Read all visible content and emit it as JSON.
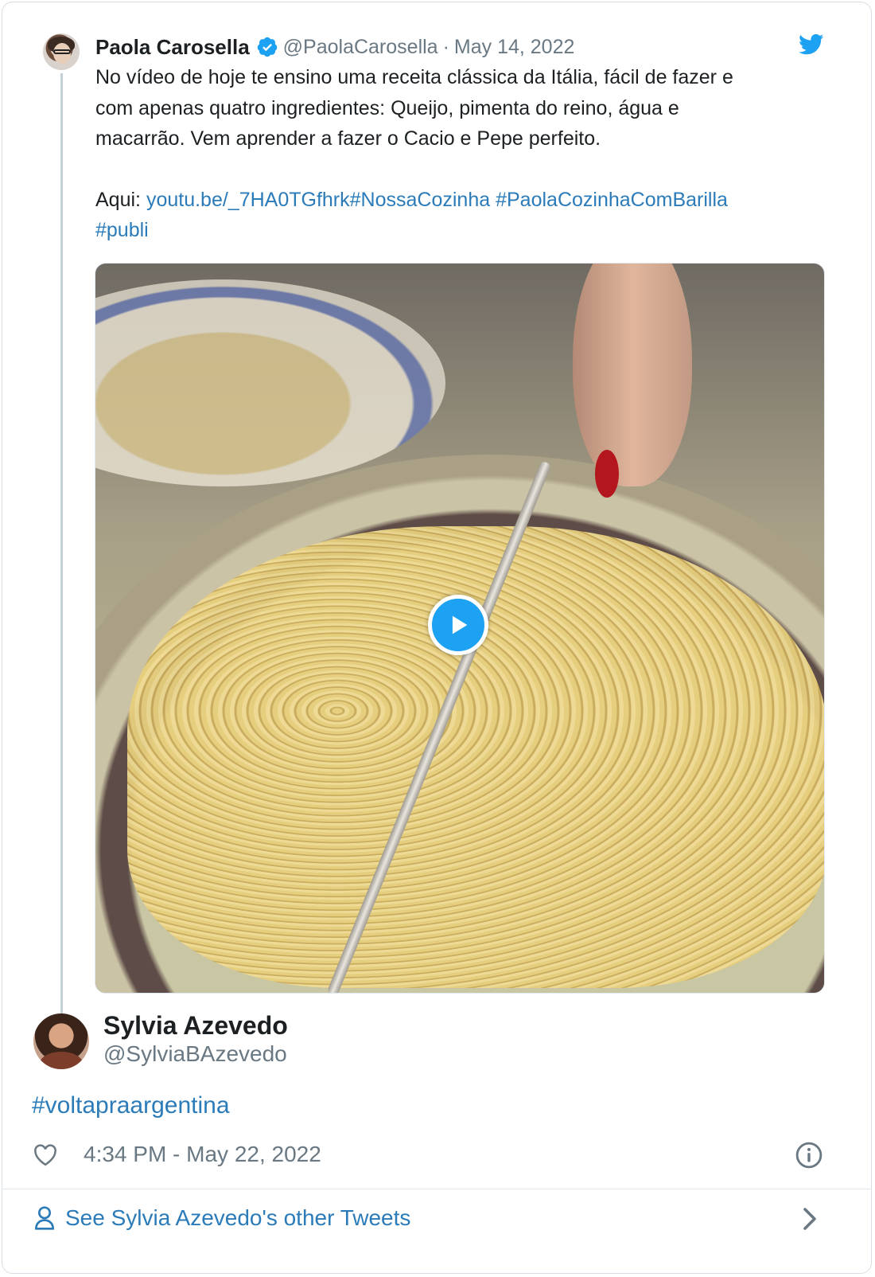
{
  "quoted_tweet": {
    "author_name": "Paola Carosella",
    "handle": "@PaolaCarosella",
    "separator": "·",
    "date": "May 14, 2022",
    "text_lines": [
      "No vídeo de hoje te ensino uma receita clássica da Itália, fácil de fazer e",
      "com apenas quatro ingredientes: Queijo, pimenta do reino, água e",
      "macarrão. Vem aprender a fazer o Cacio e Pepe perfeito."
    ],
    "links_prefix": "Aqui: ",
    "link_url": "youtu.be/_7HA0TGfhrk",
    "hashtag1": "#NossaCozinha",
    "hashtag2": "#PaolaCozinhaComBarilla",
    "hashtag3": "#publi",
    "media_icon": "play-icon"
  },
  "tweet": {
    "author_name": "Sylvia Azevedo",
    "handle": "@SylviaBAzevedo",
    "text": "#voltapraargentina",
    "timestamp": "4:34 PM - May 22, 2022"
  },
  "footer": {
    "label": "See Sylvia Azevedo's other Tweets"
  },
  "colors": {
    "link": "#2b7bb9",
    "twitter_blue": "#1da1f2",
    "secondary_text": "#697882"
  }
}
